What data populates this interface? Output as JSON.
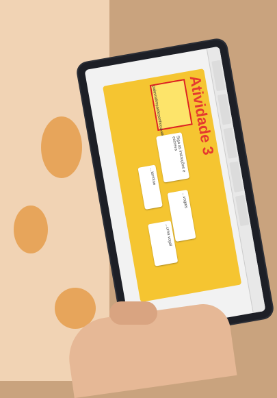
{
  "slide": {
    "title": "Atividade 3",
    "word_list": [
      "palavra",
      "limpar",
      "desenho",
      "cavalo",
      "blusa"
    ],
    "cards": [
      "...termine",
      "...vogais",
      "...uma vogal"
    ],
    "instruction": "Siga as instruções e escreva"
  },
  "colors": {
    "slide_bg": "#f5c531",
    "title": "#e53a2f",
    "device": "#1d1f26"
  }
}
